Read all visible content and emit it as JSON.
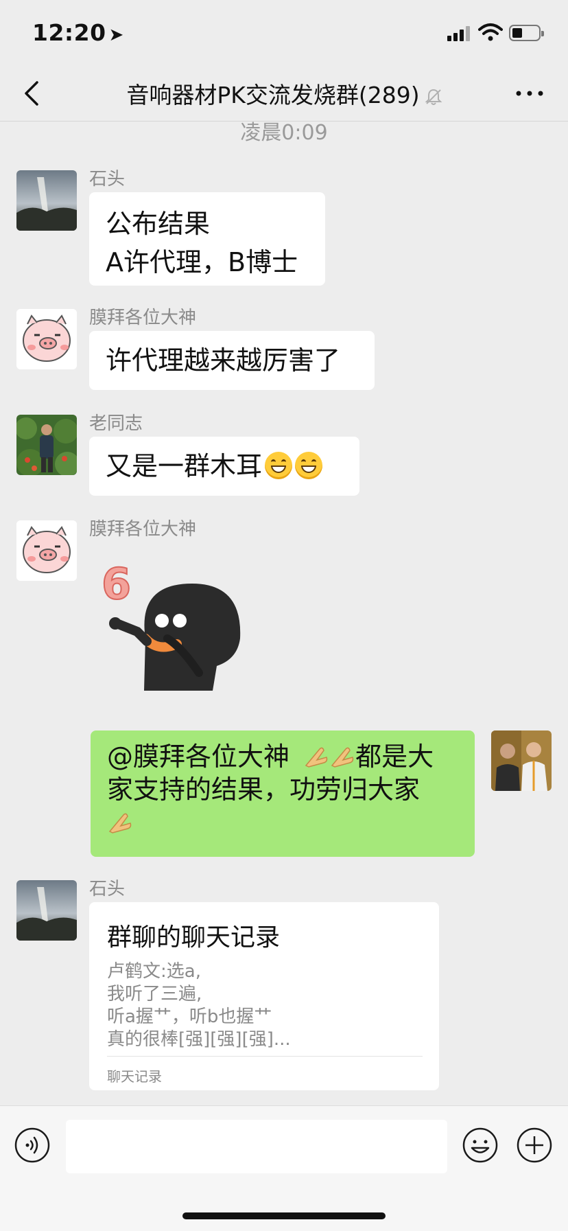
{
  "status_bar": {
    "time": "12:20"
  },
  "nav": {
    "title": "音响器材PK交流发烧群(289)"
  },
  "time_separator": "凌晨0:09",
  "messages": [
    {
      "sender": "石头",
      "lines": [
        "公布结果",
        "A许代理，B博士"
      ]
    },
    {
      "sender": "膜拜各位大神",
      "lines": [
        "许代理越来越厉害了"
      ]
    },
    {
      "sender": "老同志",
      "lines": [
        "又是一群木耳"
      ]
    },
    {
      "sender": "膜拜各位大神",
      "sticker": "6"
    },
    {
      "self": true,
      "lines": [
        "@膜拜各位大神",
        "都是大",
        "家支持的结果，功劳归大家"
      ]
    },
    {
      "sender": "石头",
      "card": {
        "title": "群聊的聊天记录",
        "lines": [
          "卢鹤文:选a,",
          "我听了三遍,",
          "听a握艹，听b也握艹",
          "真的很棒[强][强][强]..."
        ],
        "footer": "聊天记录"
      }
    }
  ],
  "input": {
    "value": ""
  },
  "colors": {
    "background": "#ededed",
    "self_bubble": "#a5e87a",
    "other_bubble": "#ffffff"
  }
}
